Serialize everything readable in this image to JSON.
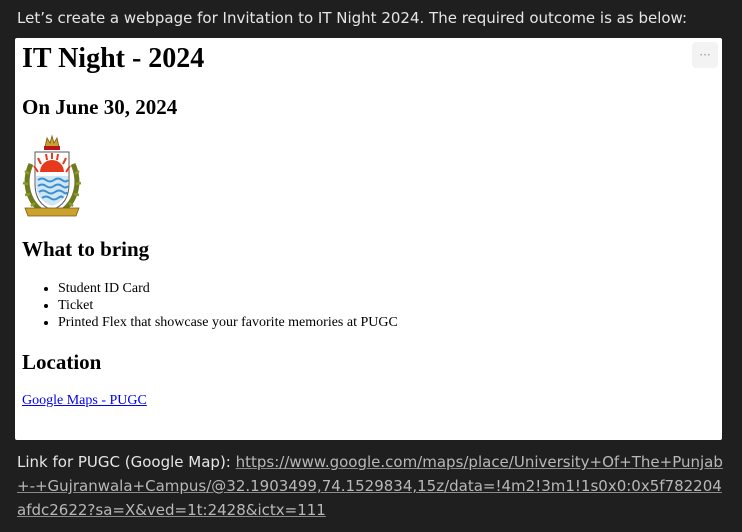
{
  "intro": {
    "text": "Let’s create a webpage for Invitation to IT Night 2024. The required outcome is as below:"
  },
  "preview": {
    "corner_button_label": "···",
    "title": "IT Night - 2024",
    "date": "On June 30, 2024",
    "logo_icon": "university-crest-logo",
    "bring_heading": "What to bring",
    "bring_items": [
      "Student ID Card",
      "Ticket",
      "Printed Flex that showcase your favorite memories at PUGC"
    ],
    "location_heading": "Location",
    "map_link": "Google Maps - PUGC"
  },
  "footer": {
    "label": "Link for PUGC (Google Map): ",
    "url": "https://www.google.com/maps/place/University+Of+The+Punjab+-+Gujranwala+Campus/@32.1903499,74.1529834,15z/data=!4m2!3m1!1s0x0:0x5f782204afdc2622?sa=X&ved=1t:2428&ictx=111"
  }
}
